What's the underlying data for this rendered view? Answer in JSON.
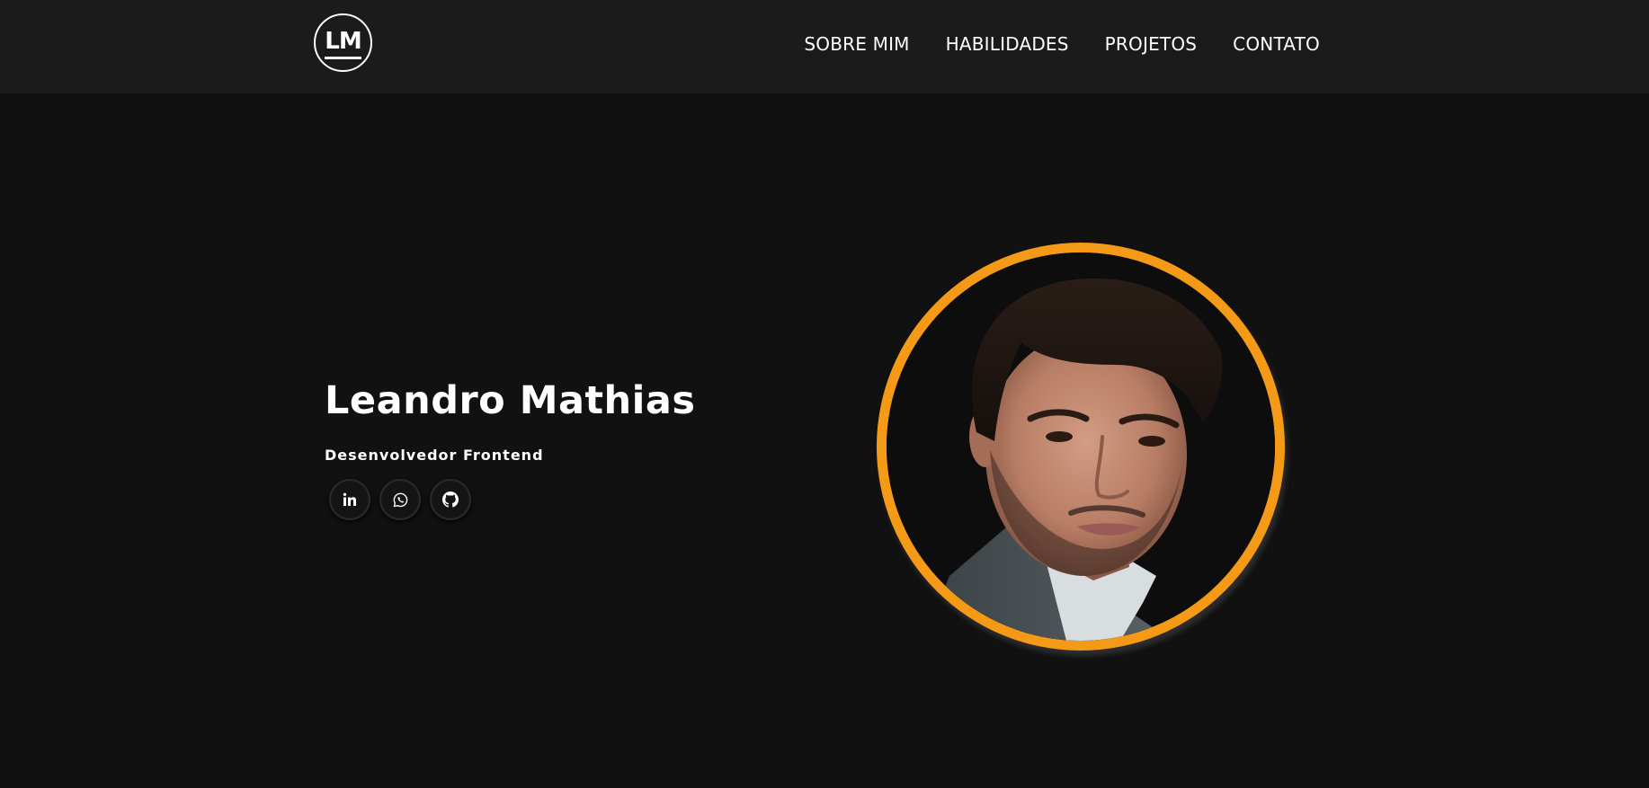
{
  "header": {
    "logo_text": "LM",
    "nav": [
      {
        "label": "SOBRE MIM"
      },
      {
        "label": "HABILIDADES"
      },
      {
        "label": "PROJETOS"
      },
      {
        "label": "CONTATO"
      }
    ]
  },
  "hero": {
    "name": "Leandro Mathias",
    "role": "Desenvolvedor Frontend",
    "socials": [
      {
        "icon": "linkedin-icon"
      },
      {
        "icon": "whatsapp-icon"
      },
      {
        "icon": "github-icon"
      }
    ]
  },
  "colors": {
    "background": "#111111",
    "header_background": "#1b1b1b",
    "accent": "#f59a16",
    "text": "#ffffff"
  }
}
